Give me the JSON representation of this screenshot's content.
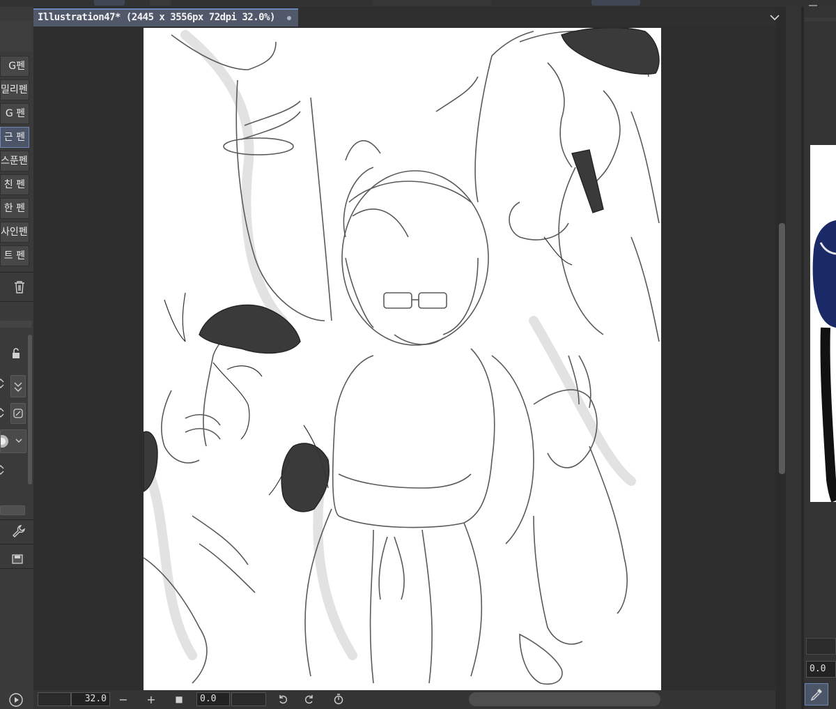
{
  "document_tab": {
    "title": "Illustration47* (2445 x 3556px 72dpi 32.0%)"
  },
  "pen_list": {
    "items": [
      {
        "label": "G펜",
        "selected": false
      },
      {
        "label": "밀리펜",
        "selected": false
      },
      {
        "label": "G 펜",
        "selected": false
      },
      {
        "label": "근 펜",
        "selected": true
      },
      {
        "label": "스푼펜",
        "selected": false
      },
      {
        "label": "친 펜",
        "selected": false
      },
      {
        "label": "한 펜",
        "selected": false
      },
      {
        "label": "사인펜",
        "selected": false
      },
      {
        "label": "트 펜",
        "selected": false
      }
    ]
  },
  "status_bar": {
    "zoom": "32.0",
    "rotation": "0.0"
  },
  "right_panel": {
    "value": "0.0"
  },
  "icons": [
    "trash-icon",
    "lock-icon",
    "stepper-icon",
    "checkmark-icon",
    "circle-slash-icon",
    "brush-tip-icon",
    "chevron-down-icon",
    "wrench-icon",
    "save-icon",
    "play-icon",
    "zoom-out-icon",
    "zoom-in-icon",
    "rotate-left-icon",
    "rotate-right-icon",
    "reset-rotation-icon",
    "eyedropper-icon",
    "menu-icon"
  ],
  "colors": {
    "accent": "#6f86b8",
    "tab": "#50586a",
    "panel": "#3a3a3a",
    "canvas_bg": "#2d2d2d",
    "navy": "#1b2a66"
  }
}
